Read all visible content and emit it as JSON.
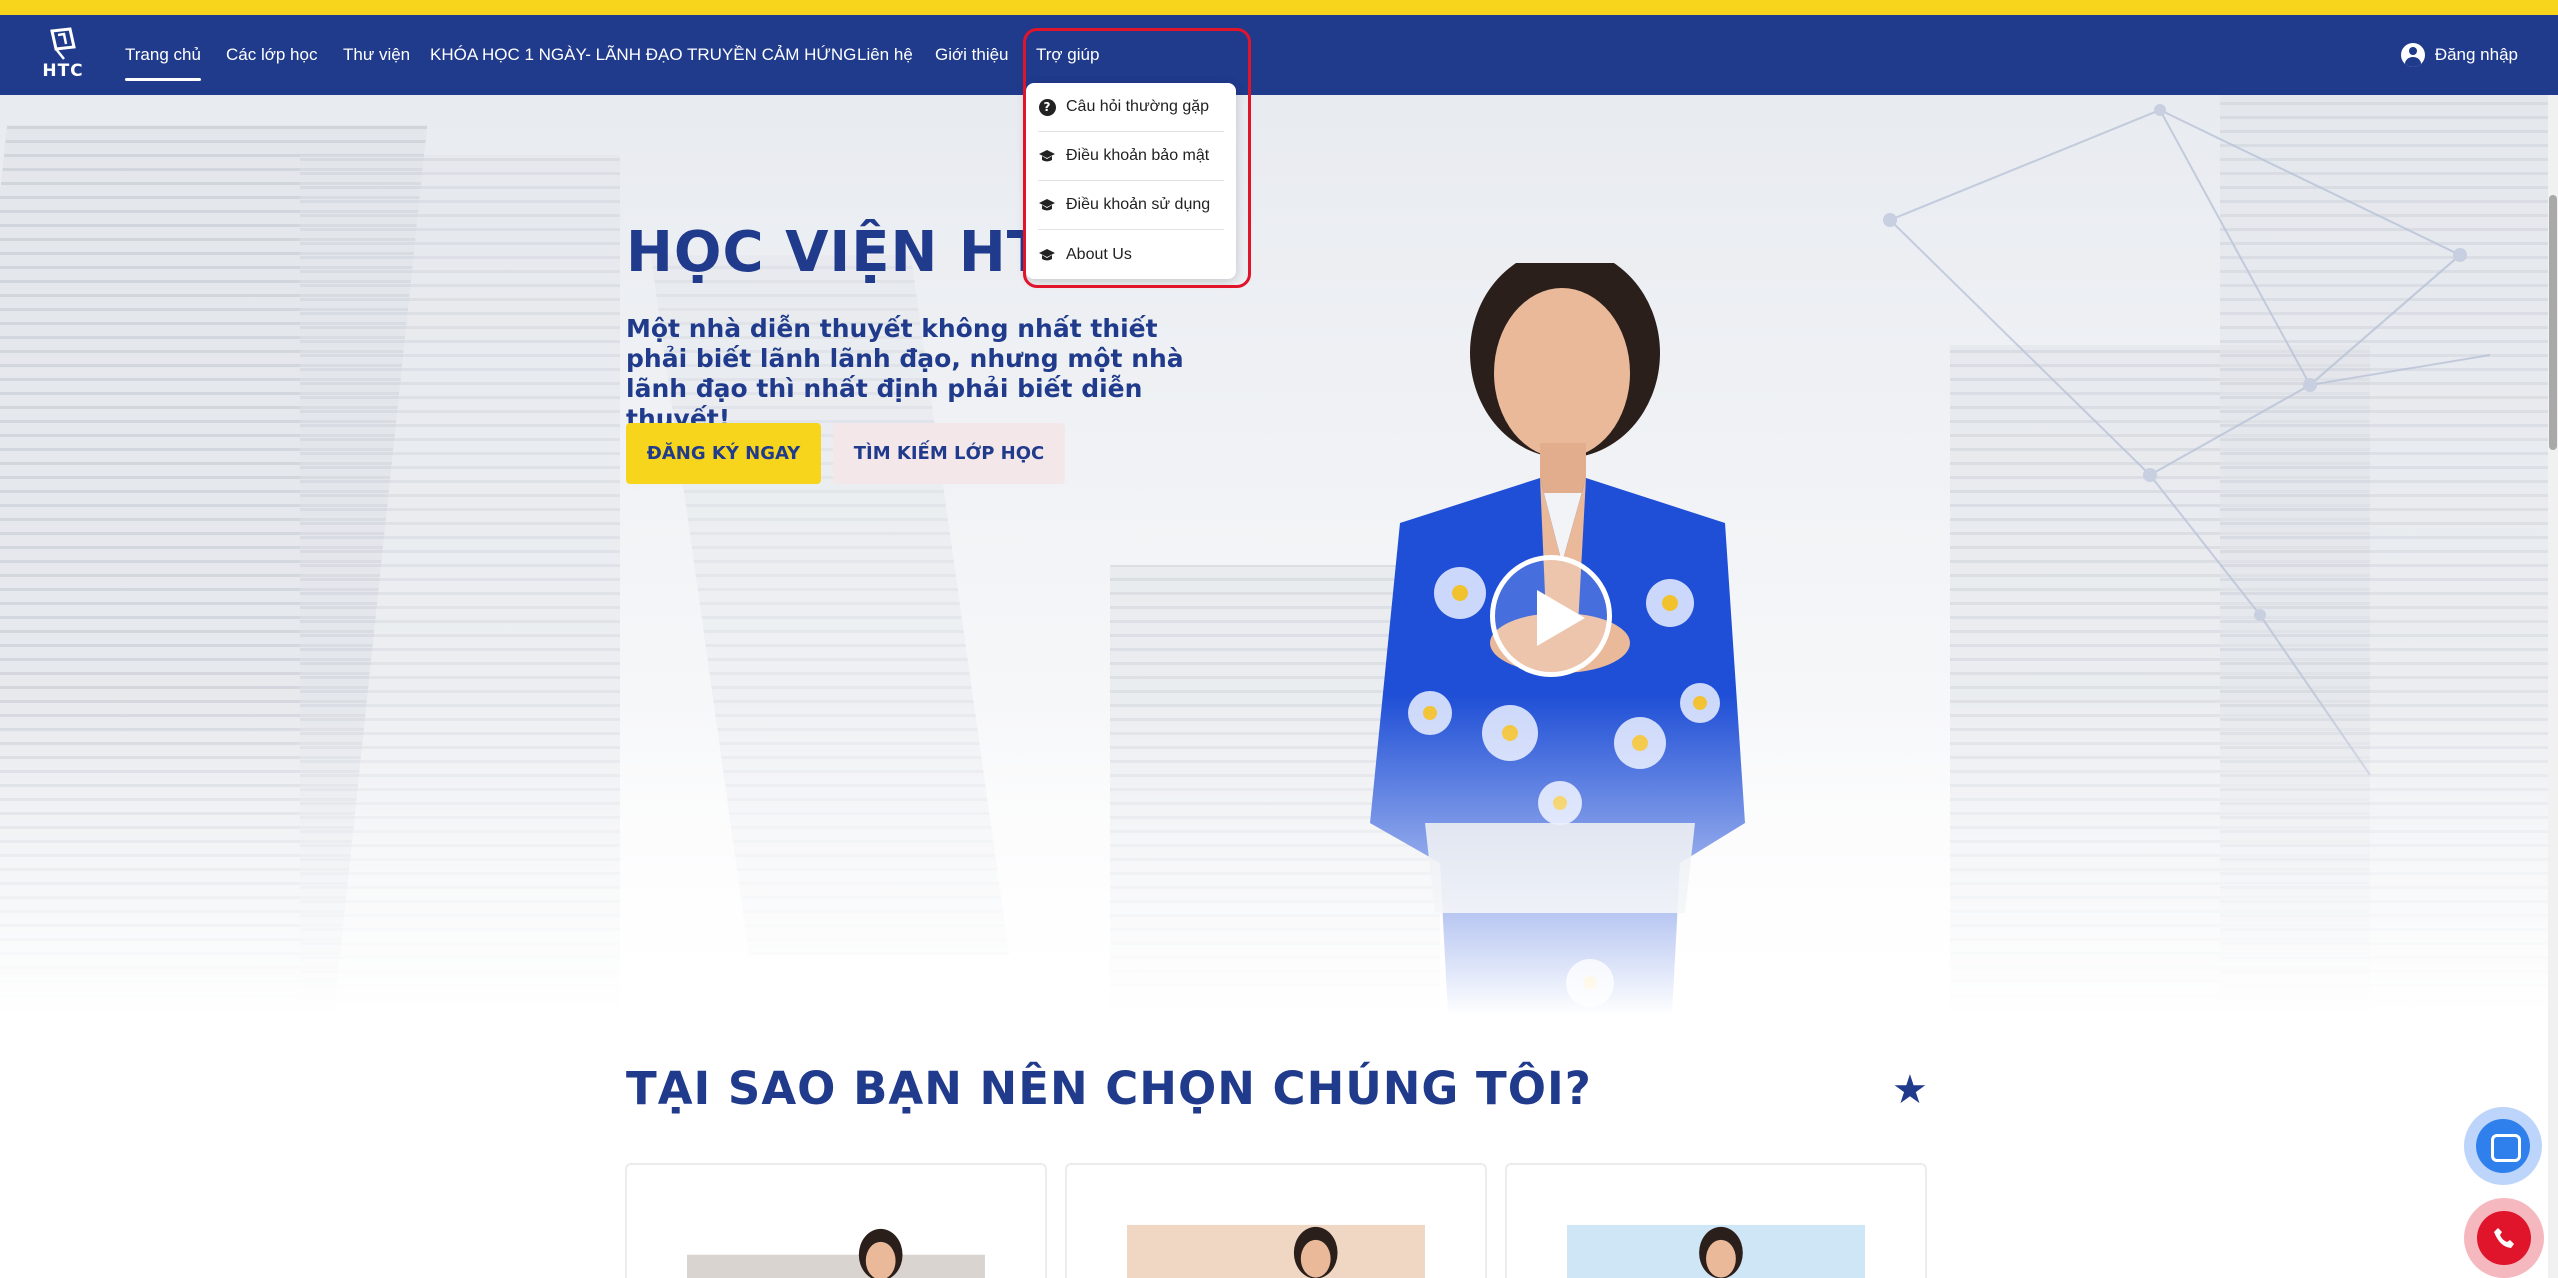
{
  "logo": {
    "text": "HTC"
  },
  "nav": {
    "items": [
      {
        "label": "Trang chủ",
        "active": true
      },
      {
        "label": "Các lớp học"
      },
      {
        "label": "Thư viện"
      },
      {
        "label": "KHÓA HỌC 1 NGÀY- LÃNH ĐẠO TRUYỀN CẢM HỨNG"
      },
      {
        "label": "Liên hệ"
      },
      {
        "label": "Giới thiệu"
      },
      {
        "label": "Trợ giúp"
      }
    ],
    "login_label": "Đăng nhập"
  },
  "help_menu": {
    "items": [
      {
        "label": "Câu hỏi thường gặp",
        "icon": "question-circle-icon"
      },
      {
        "label": "Điều khoản bảo mật",
        "icon": "graduation-cap-icon"
      },
      {
        "label": "Điều khoản sử dụng",
        "icon": "graduation-cap-icon"
      },
      {
        "label": "About Us",
        "icon": "graduation-cap-icon"
      }
    ]
  },
  "hero": {
    "title": "HỌC VIỆN HTC",
    "subtitle": "Một nhà diễn thuyết không nhất thiết phải biết lãnh lãnh đạo, nhưng một nhà lãnh đạo thì nhất định phải biết diễn thuyết!",
    "primary_button": "ĐĂNG KÝ NGAY",
    "secondary_button": "TÌM KIẾM LỚP HỌC"
  },
  "why_section": {
    "title": "TẠI SAO BẠN NÊN CHỌN CHÚNG TÔI?"
  },
  "colors": {
    "brand_blue": "#203a8c",
    "accent_yellow": "#f7d51d",
    "highlight_red": "#e0142b",
    "zalo_blue": "#2f80ed"
  }
}
